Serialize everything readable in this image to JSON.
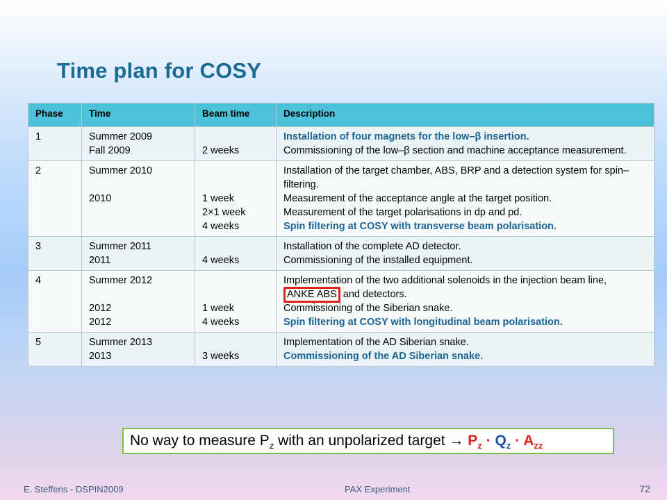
{
  "slide": {
    "title": "Time plan for COSY"
  },
  "table": {
    "headers": [
      "Phase",
      "Time",
      "Beam time",
      "Description"
    ],
    "rows": [
      {
        "phase": "1",
        "time": [
          "Summer 2009",
          "Fall 2009"
        ],
        "beam": [
          "",
          "2 weeks"
        ],
        "desc": [
          "Installation of four magnets for the low–β insertion.",
          "Commissioning of the low–β section and machine acceptance measurement."
        ]
      },
      {
        "phase": "2",
        "time": [
          "Summer 2010",
          "",
          "2010"
        ],
        "beam": [
          "",
          "",
          "1 week",
          "2×1 week",
          "4 weeks"
        ],
        "desc": [
          "Installation of the target chamber, ABS, BRP and a detection system for spin–filtering.",
          "Measurement of the acceptance angle at the target position.",
          "Measurement of the target polarisations in dp and pd.",
          "Spin filtering at COSY with transverse beam polarisation."
        ]
      },
      {
        "phase": "3",
        "time": [
          "Summer 2011",
          "2011"
        ],
        "beam": [
          "",
          "4 weeks"
        ],
        "desc": [
          "Installation of the complete AD detector.",
          "Commissioning of the installed equipment."
        ]
      },
      {
        "phase": "4",
        "time": [
          "Summer 2012",
          "",
          "2012",
          "2012"
        ],
        "beam": [
          "",
          "",
          "1 week",
          "4 weeks"
        ],
        "desc": {
          "line1_before": "Implementation of the two additional solenoids in the injection beam line,",
          "line1_boxed": "ANKE ABS",
          "line1_after": "and detectors.",
          "line2": "Commissioning of the Siberian snake.",
          "line3": "Spin filtering at COSY with longitudinal beam polarisation."
        }
      },
      {
        "phase": "5",
        "time": [
          "Summer 2013",
          "2013"
        ],
        "beam": [
          "",
          "3 weeks"
        ],
        "desc": [
          "Implementation of the AD Siberian snake.",
          "Commissioning of the AD Siberian snake."
        ]
      }
    ]
  },
  "note": {
    "text_before": "No way to measure P",
    "sub_z": "z",
    "text_middle": " with an unpolarized target → ",
    "p": "P",
    "p_sub": "z",
    "dot1": " · ",
    "q": "Q",
    "q_sub": "z",
    "dot2": " · ",
    "a": "A",
    "a_sub": "zz",
    "border_color": "#7fc241",
    "accent_red": "#e0201b",
    "accent_blue": "#1c4fa0"
  },
  "footer": {
    "author": "E. Steffens  -  DSPIN2009",
    "center": "PAX Experiment",
    "page": "72"
  },
  "colors": {
    "title": "#1a6a96",
    "header_bg": "#4cc1d9",
    "highlight_text": "#1c6494"
  }
}
